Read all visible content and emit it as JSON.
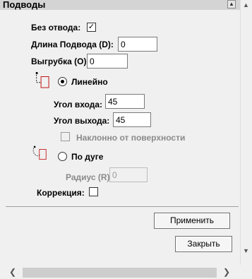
{
  "panel": {
    "title": "Подводы",
    "collapse_glyph": "▲"
  },
  "form": {
    "no_lead": {
      "label": "Без отвода:",
      "checked": true,
      "mark": "✓"
    },
    "lead_length": {
      "label": "Длина Подвода (D):",
      "value": "0"
    },
    "cutout": {
      "label": "Выгрубка (O):",
      "value": "0"
    },
    "linear": {
      "label": "Линейно",
      "selected": true,
      "entry_angle": {
        "label": "Угол входа:",
        "value": "45"
      },
      "exit_angle": {
        "label": "Угол выхода:",
        "value": "45"
      },
      "tilt": {
        "label": "Наклонно от поверхности",
        "checked": false,
        "enabled": false
      }
    },
    "arc": {
      "label": "По дуге",
      "selected": false,
      "radius": {
        "label": "Радиус (R):",
        "value": "0",
        "enabled": false
      }
    },
    "correction": {
      "label": "Коррекция:",
      "checked": false
    }
  },
  "buttons": {
    "apply": "Применить",
    "close": "Закрыть"
  },
  "scrollbars": {
    "up_glyph": "▲",
    "down_glyph": "▼",
    "left_glyph": "❮",
    "right_glyph": "❯"
  },
  "icons": {
    "linear": "linear-lead-icon",
    "arc": "arc-lead-icon",
    "accent": "#c00000"
  }
}
